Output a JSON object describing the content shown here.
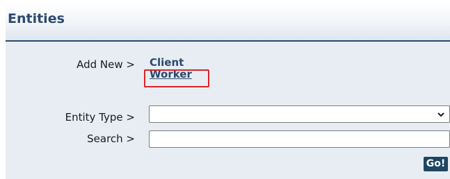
{
  "panel": {
    "title": "Entities"
  },
  "add_new": {
    "label": "Add New >",
    "links": {
      "client": "Client",
      "worker": "Worker"
    }
  },
  "entity_type": {
    "label": "Entity Type >",
    "selected_value": "",
    "icon": "chevron-down-icon"
  },
  "search": {
    "label": "Search >",
    "value": "",
    "placeholder": ""
  },
  "go_button": {
    "label": "Go!"
  },
  "colors": {
    "title": "#2b4a6e",
    "link": "#2b4a6e",
    "highlight": "#d8232a",
    "go_button_bg": "#1f4664",
    "panel_bg": "#e8edf3"
  }
}
